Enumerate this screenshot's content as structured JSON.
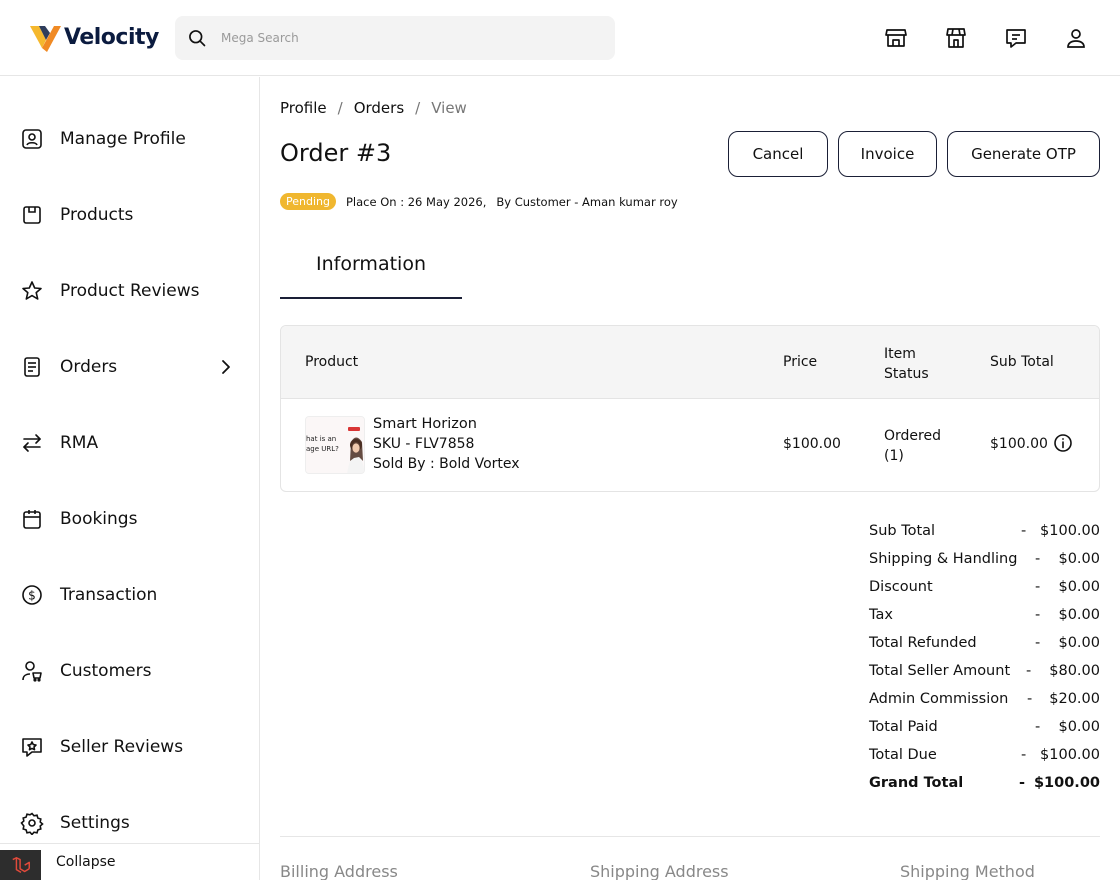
{
  "header": {
    "brand": "Velocity",
    "search_placeholder": "Mega Search",
    "icons": [
      "store-icon",
      "shop-icon",
      "message-icon",
      "user-icon"
    ]
  },
  "sidebar": {
    "items": [
      {
        "label": "Manage Profile",
        "icon": "profile-icon"
      },
      {
        "label": "Products",
        "icon": "box-icon"
      },
      {
        "label": "Product Reviews",
        "icon": "star-icon"
      },
      {
        "label": "Orders",
        "icon": "orders-icon"
      },
      {
        "label": "RMA",
        "icon": "exchange-icon"
      },
      {
        "label": "Bookings",
        "icon": "calendar-icon"
      },
      {
        "label": "Transaction",
        "icon": "dollar-icon"
      },
      {
        "label": "Customers",
        "icon": "customers-icon"
      },
      {
        "label": "Seller Reviews",
        "icon": "review-icon"
      },
      {
        "label": "Settings",
        "icon": "gear-icon"
      }
    ],
    "collapse_label": "Collapse"
  },
  "breadcrumb": {
    "items": [
      "Profile",
      "Orders"
    ],
    "current": "View",
    "separator": "/"
  },
  "page": {
    "title": "Order #3",
    "buttons": {
      "cancel": "Cancel",
      "invoice": "Invoice",
      "otp": "Generate OTP"
    },
    "status_badge": "Pending",
    "placed_on": "Place On : 26 May 2026,",
    "by_customer": "By Customer - Aman kumar roy",
    "tab": "Information"
  },
  "table": {
    "headers": {
      "product": "Product",
      "price": "Price",
      "status_1": "Item",
      "status_2": "Status",
      "subtotal": "Sub Total"
    },
    "rows": [
      {
        "name": "Smart Horizon",
        "sku": "SKU - FLV7858",
        "seller": "Sold By : Bold Vortex",
        "price": "$100.00",
        "status_1": "Ordered",
        "status_2": "(1)",
        "subtotal": "$100.00",
        "thumb_text_1": "hat is an",
        "thumb_text_2": "age URL?"
      }
    ]
  },
  "totals": [
    {
      "label": "Sub Total",
      "dash": "-",
      "value": "$100.00"
    },
    {
      "label": "Shipping & Handling",
      "dash": "-",
      "value": "$0.00"
    },
    {
      "label": "Discount",
      "dash": "-",
      "value": "$0.00"
    },
    {
      "label": "Tax",
      "dash": "-",
      "value": "$0.00"
    },
    {
      "label": "Total Refunded",
      "dash": "-",
      "value": "$0.00"
    },
    {
      "label": "Total Seller Amount",
      "dash": "-",
      "value": "$80.00"
    },
    {
      "label": "Admin Commission",
      "dash": "-",
      "value": "$20.00"
    },
    {
      "label": "Total Paid",
      "dash": "-",
      "value": "$0.00"
    },
    {
      "label": "Total Due",
      "dash": "-",
      "value": "$100.00"
    },
    {
      "label": "Grand Total",
      "dash": "-",
      "value": "$100.00"
    }
  ],
  "sections": {
    "billing": "Billing Address",
    "shipping": "Shipping Address",
    "method": "Shipping Method"
  },
  "colors": {
    "badge": "#f0b72f",
    "logo_yellow": "#f5b82e",
    "logo_orange": "#f08a24",
    "brand_navy": "#0b1b3f"
  }
}
